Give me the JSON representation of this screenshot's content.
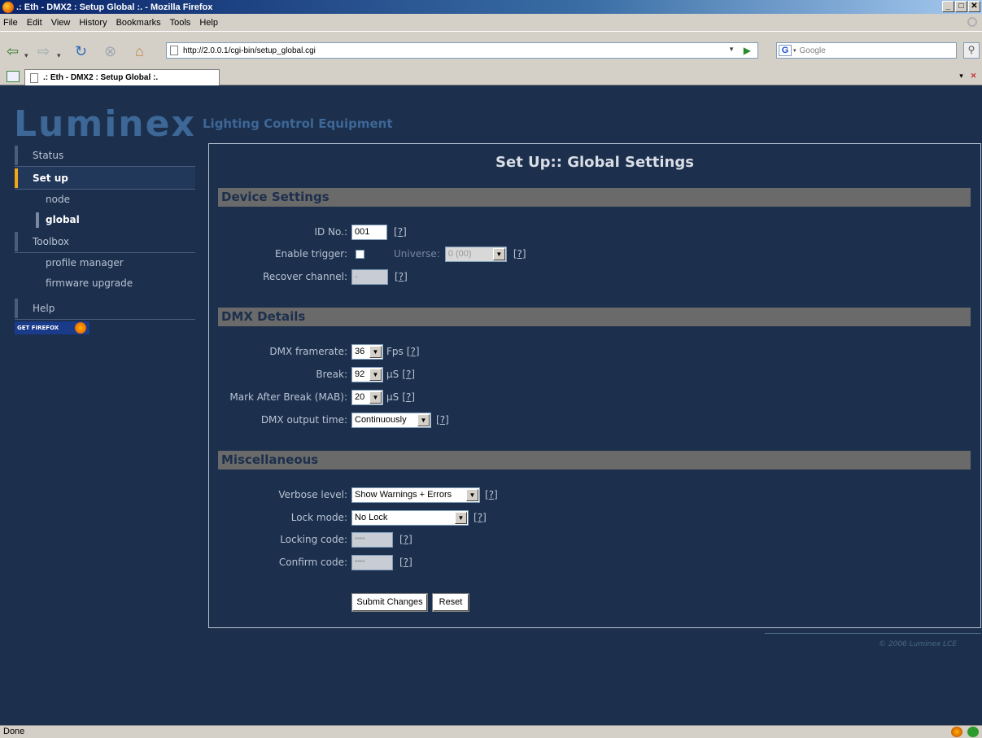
{
  "window": {
    "title": ".: Eth - DMX2 : Setup Global :. - Mozilla Firefox",
    "min": "_",
    "max": "□",
    "close": "✕"
  },
  "menu": [
    "File",
    "Edit",
    "View",
    "History",
    "Bookmarks",
    "Tools",
    "Help"
  ],
  "nav": {
    "url": "http://2.0.0.1/cgi-bin/setup_global.cgi",
    "search_placeholder": "Google",
    "search_engine": "G"
  },
  "tab": {
    "title": ".: Eth - DMX2 : Setup Global :."
  },
  "brand": {
    "logo": "Luminex",
    "tagline": "Lighting Control Equipment"
  },
  "sidebar": {
    "status": "Status",
    "setup": "Set up",
    "node": "node",
    "global": "global",
    "toolbox": "Toolbox",
    "profile_manager": "profile manager",
    "firmware_upgrade": "firmware upgrade",
    "help": "Help",
    "getfirefox": "GET FIREFOX"
  },
  "page": {
    "title": "Set Up:: Global Settings",
    "help_mark": "?"
  },
  "device": {
    "heading": "Device Settings",
    "id_label": "ID No.:",
    "id_value": "001",
    "trigger_label": "Enable trigger:",
    "universe_label": "Universe:",
    "universe_value": "0 (00)",
    "recover_label": "Recover channel:",
    "recover_value": "-"
  },
  "dmx": {
    "heading": "DMX Details",
    "framerate_label": "DMX framerate:",
    "framerate_value": "36",
    "framerate_unit": "Fps",
    "break_label": "Break:",
    "break_value": "92",
    "break_unit": "µS",
    "mab_label": "Mark After Break (MAB):",
    "mab_value": "20",
    "mab_unit": "µS",
    "output_label": "DMX output time:",
    "output_value": "Continuously"
  },
  "misc": {
    "heading": "Miscellaneous",
    "verbose_label": "Verbose level:",
    "verbose_value": "Show Warnings + Errors",
    "lock_label": "Lock mode:",
    "lock_value": "No Lock",
    "locking_label": "Locking code:",
    "locking_value": "****",
    "confirm_label": "Confirm code:",
    "confirm_value": "****"
  },
  "buttons": {
    "submit": "Submit Changes",
    "reset": "Reset"
  },
  "footer": {
    "copyright": "© 2006 Luminex LCE"
  },
  "status": {
    "text": "Done"
  },
  "colors": {
    "page_bg": "#1c2f4c",
    "accent": "#f0a818",
    "section_bg": "#6a6a6a"
  }
}
